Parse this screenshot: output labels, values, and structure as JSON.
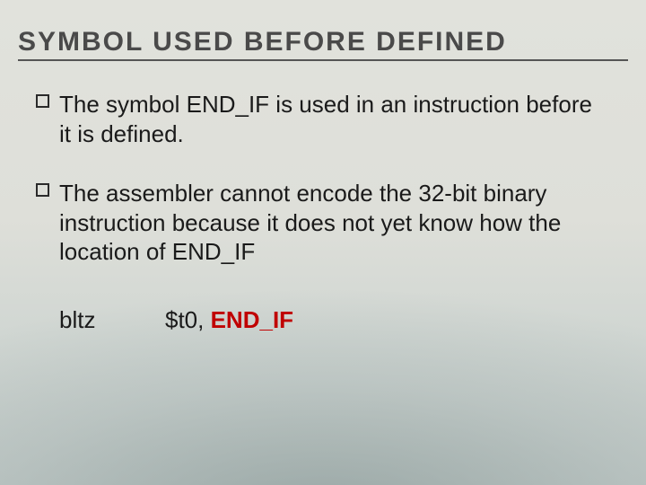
{
  "title": "SYMBOL USED BEFORE DEFINED",
  "bullets": [
    "The symbol END_IF is used in an instruction before it is defined.",
    "The assembler cannot encode the 32-bit binary instruction because it does not yet know how the location of END_IF"
  ],
  "code": {
    "mnemonic": "bltz",
    "arg_plain": "$t0, ",
    "arg_highlight": "END_IF"
  }
}
